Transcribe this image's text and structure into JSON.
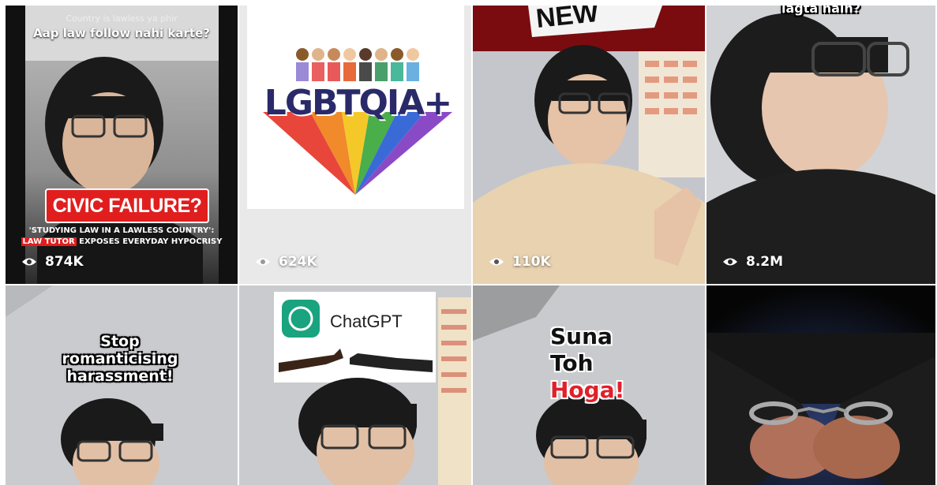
{
  "tiles": [
    {
      "views": "874K",
      "caption_top_small": "Country is lawless ya phir",
      "caption_top": "Aap law follow nahi karte?",
      "banner": "CIVIC FAILURE?",
      "subtitle_line1": "'STUDYING LAW IN A LAWLESS COUNTRY':",
      "subtitle_highlight": "LAW TUTOR",
      "subtitle_line2_rest": " EXPOSES EVERYDAY HYPOCRISY"
    },
    {
      "views": "624K",
      "logo_text": "LGBTQIA+"
    },
    {
      "views": "110K",
      "sign_text": "NEW"
    },
    {
      "views": "8.2M",
      "caption_top": "lagta hain?"
    },
    {
      "caption": "Stop romanticising harassment!"
    },
    {
      "logo_text": "ChatGPT"
    },
    {
      "caption_line1": "Suna",
      "caption_line2": "Toh",
      "caption_line3": "Hoga!"
    },
    {}
  ],
  "colors": {
    "banner_red": "#e01e1e",
    "hoga_red": "#e0202a",
    "chatgpt_green": "#19a37f"
  }
}
